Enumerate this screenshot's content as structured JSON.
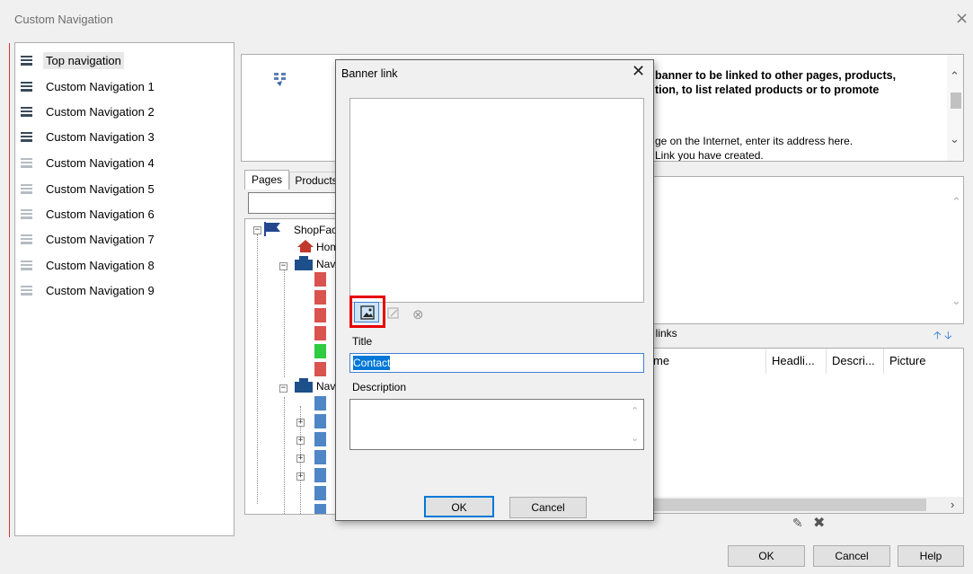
{
  "window": {
    "title": "Custom Navigation",
    "close_glyph": "×"
  },
  "navigation": {
    "items": [
      {
        "label": "Top navigation",
        "selected": true,
        "active": true
      },
      {
        "label": "Custom Navigation 1",
        "active": true
      },
      {
        "label": "Custom Navigation 2",
        "active": true
      },
      {
        "label": "Custom Navigation 3",
        "active": true
      },
      {
        "label": "Custom Navigation 4",
        "active": false
      },
      {
        "label": "Custom Navigation 5",
        "active": false
      },
      {
        "label": "Custom Navigation 6",
        "active": false
      },
      {
        "label": "Custom Navigation 7",
        "active": false
      },
      {
        "label": "Custom Navigation 8",
        "active": false
      },
      {
        "label": "Custom Navigation 9",
        "active": false
      }
    ]
  },
  "info": {
    "bold_line1": "banner to be linked to other pages, products,",
    "bold_line2": "tion, to list related products or to promote",
    "text_line1": "ge on the Internet, enter its address here.",
    "text_line2": "Link you have created."
  },
  "tabs": {
    "pages": "Pages",
    "products": "Products"
  },
  "tree": {
    "root": "ShopFac",
    "home": "Hom",
    "nav1": "Navi",
    "nav2": "Navi"
  },
  "links": {
    "label": "f links",
    "up_arrow": "🡡",
    "down_arrow": "🡣",
    "columns": [
      "me",
      "Headli...",
      "Descri...",
      "Picture"
    ]
  },
  "buttons": {
    "ok": "OK",
    "cancel": "Cancel",
    "help": "Help"
  },
  "dialog": {
    "title": "Banner link",
    "close_glyph": "✕",
    "title_label": "Title",
    "title_value": "Contact",
    "description_label": "Description",
    "description_value": "",
    "ok": "OK",
    "cancel": "Cancel"
  },
  "colors": {
    "highlight": "#e60000",
    "accent": "#0078d7",
    "page_red": "#d9534f",
    "page_blue": "#4f86c6",
    "page_green": "#2ecc40"
  }
}
